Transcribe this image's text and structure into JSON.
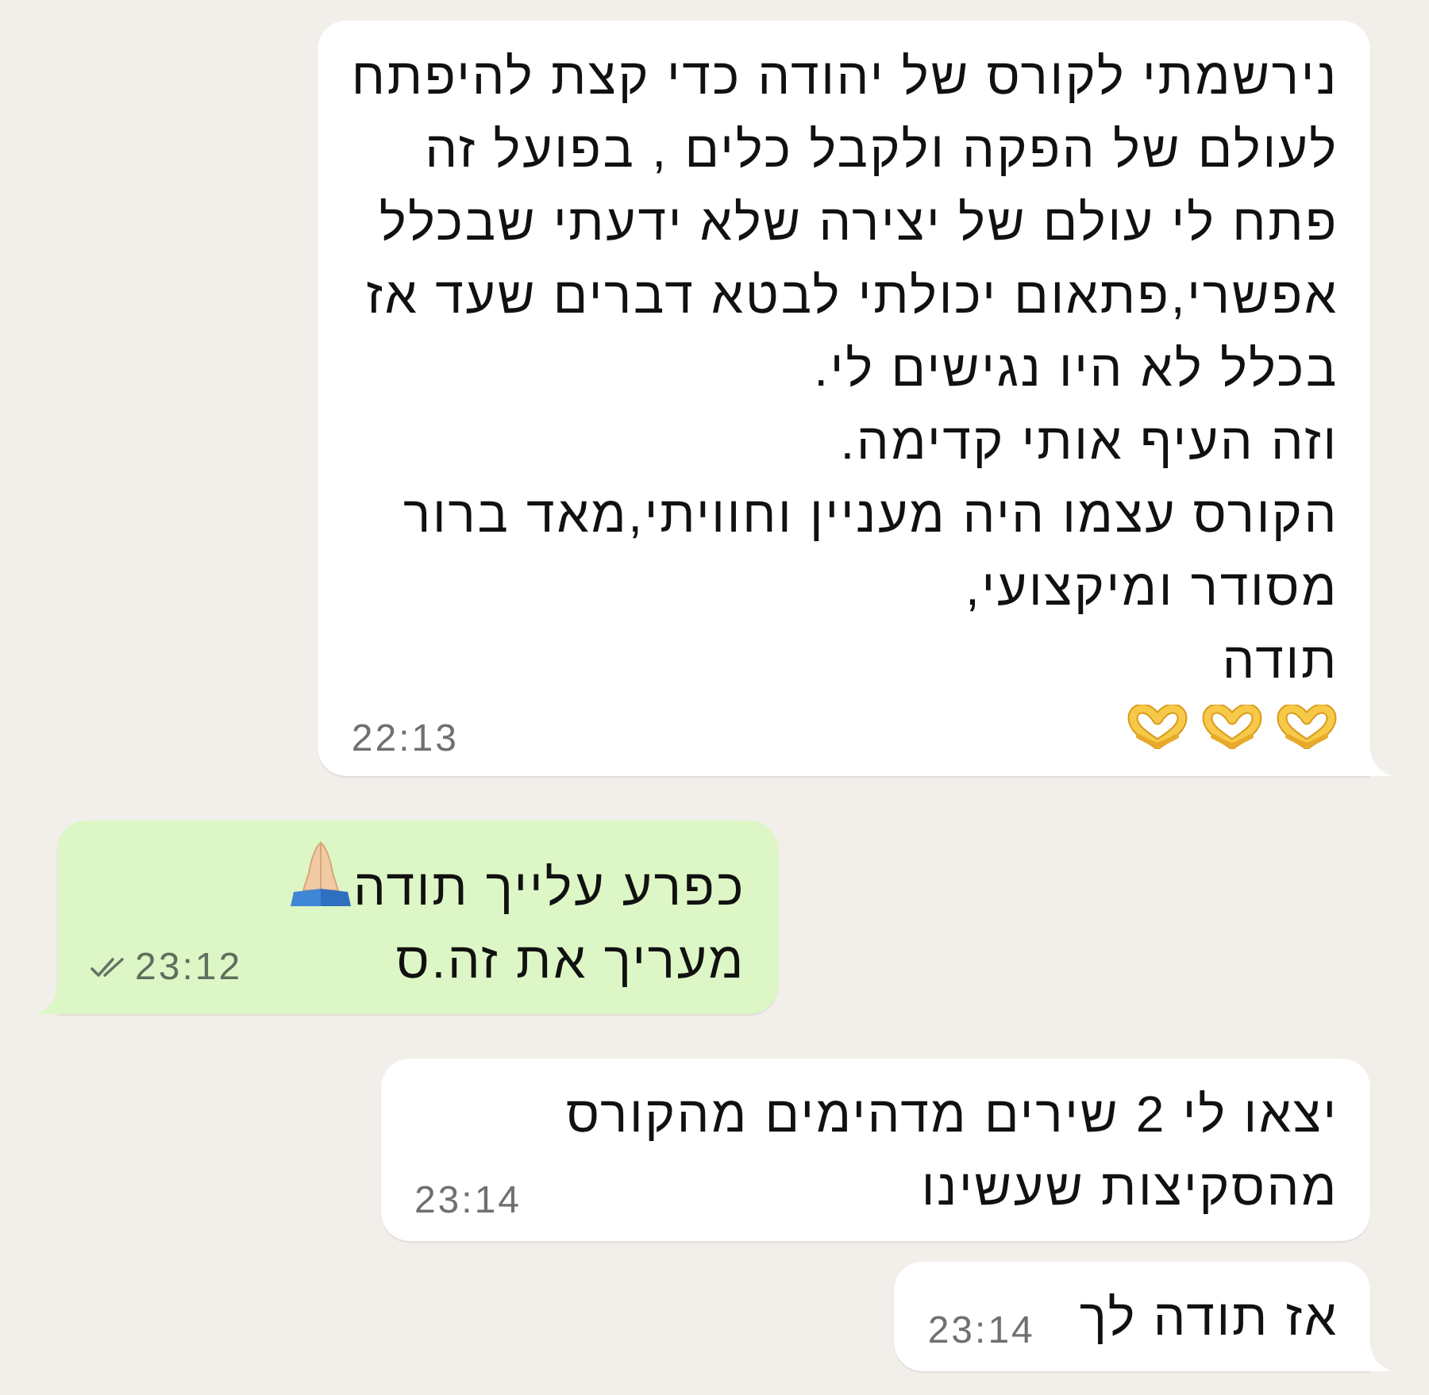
{
  "messages": [
    {
      "kind": "incoming",
      "text": "נירשמתי לקורס של יהודה כדי קצת להיפתח\nלעולם של הפקה ולקבל כלים , בפועל זה\nפתח לי עולם של יצירה שלא ידעתי שבכלל\nאפשרי,פתאום יכולתי לבטא דברים שעד אז\nבכלל לא היו נגישים לי.\nוזה העיף אותי קדימה.\nהקורס עצמו היה מעניין וחוויתי,מאד ברור\nמסודר ומיקצועי,\nתודה",
      "emoji": [
        {
          "kind": "heart_hands"
        },
        {
          "kind": "heart_hands"
        },
        {
          "kind": "heart_hands"
        }
      ],
      "emoji_inline": false,
      "time": "22:13",
      "tail": true
    },
    {
      "kind": "outgoing",
      "text": "כפרע עלייך תודה\nמעריך את זה.ס",
      "emoji": [
        {
          "kind": "folded_hands"
        }
      ],
      "emoji_inline": true,
      "time": "23:12",
      "read": false,
      "tail": true
    },
    {
      "kind": "incoming",
      "text": "יצאו לי 2 שירים מדהימים מהקורס\nמהסקיצות שעשינו",
      "time": "23:14",
      "tail": false
    },
    {
      "kind": "incoming",
      "text": "אז תודה לך",
      "time": "23:14",
      "tail": true
    }
  ]
}
